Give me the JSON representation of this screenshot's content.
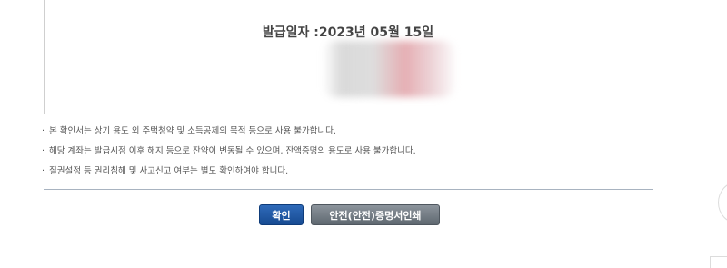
{
  "certificate": {
    "issue_date": "발급일자 :2023년 05월 15일"
  },
  "notes": [
    "본 확인서는 상기 용도 외 주택청약 및 소득공제의 목적 등으로 사용 불가합니다.",
    "해당 계좌는 발급시점 이후 해지 등으로 잔약이 변동될 수 있으며, 잔액증명의 용도로 사용 불가합니다.",
    "질권설정 등 권리침해 및 사고신고 여부는 별도 확인하여야 합니다."
  ],
  "buttons": {
    "confirm": "확인",
    "safe_print": "안전(안전)증명서인쇄"
  },
  "colors": {
    "confirm_button": "#1f5aa6",
    "print_button": "#6e7780"
  }
}
